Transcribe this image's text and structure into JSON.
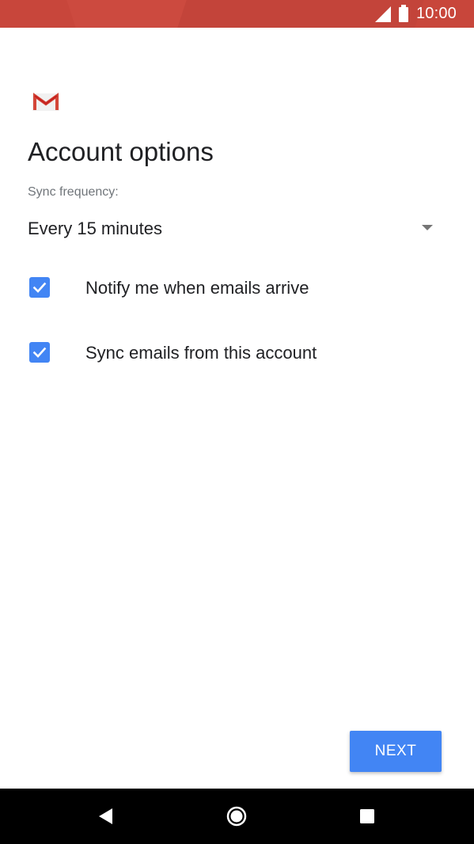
{
  "status_bar": {
    "time": "10:00",
    "icons": [
      "signal-icon",
      "battery-icon"
    ],
    "color": "#c8463b"
  },
  "app": {
    "logo": "gmail-logo-icon",
    "logo_colors": {
      "red": "#d44638",
      "gray": "#e4e4e4"
    }
  },
  "page": {
    "title": "Account options",
    "sync_frequency_label": "Sync frequency:",
    "sync_frequency_value": "Every 15 minutes",
    "options": [
      {
        "label": "Notify me when emails arrive",
        "checked": true
      },
      {
        "label": "Sync emails from this account",
        "checked": true
      }
    ],
    "accent_color": "#4285f4"
  },
  "actions": {
    "next_label": "NEXT"
  },
  "nav_bar": {
    "icons": [
      "back-icon",
      "home-icon",
      "recents-icon"
    ]
  }
}
